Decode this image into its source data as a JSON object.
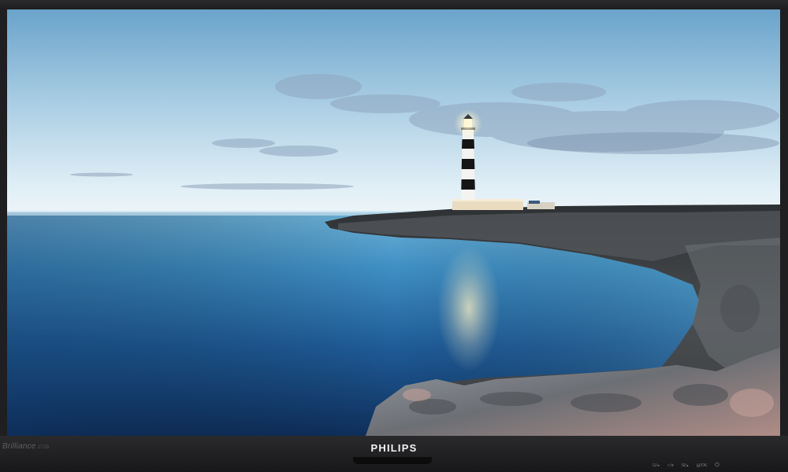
{
  "monitor": {
    "brand": "PHILIPS",
    "series": "Brilliance",
    "model": "272B"
  },
  "screen": {
    "wallpaper": "lighthouse-on-rocky-coast-at-dusk"
  },
  "controls": {
    "buttons": [
      {
        "icon": "input-source-icon",
        "label": "⊡/◂"
      },
      {
        "icon": "brightness-icon",
        "label": "✧/▾"
      },
      {
        "icon": "smartimage-icon",
        "label": "SI/▴"
      },
      {
        "icon": "menu-ok-icon",
        "label": "▤/OK"
      }
    ],
    "power_icon": "⏻"
  },
  "colors": {
    "bezel": "#1f1f21",
    "sky_top": "#6fa6cc",
    "sky_horizon": "#eaf3f8",
    "sea_deep": "#123b6b",
    "sea_light": "#5aaed6",
    "logo": "#f2f2f2"
  }
}
